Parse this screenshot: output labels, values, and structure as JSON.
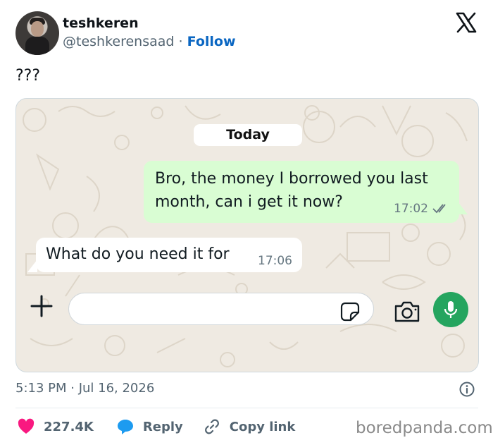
{
  "author": {
    "name": "teshkeren",
    "handle": "@teshkerensaad",
    "separator": "·",
    "follow_label": "Follow",
    "avatar_icon": "profile-photo"
  },
  "platform_logo": "x-logo",
  "tweet": {
    "text": "???",
    "posted": "5:13 PM · Jul 16, 2026"
  },
  "chat": {
    "date_chip": "Today",
    "messages": [
      {
        "direction": "outgoing",
        "text": "Bro, the money I borrowed you last month, can i get it now?",
        "time": "17:02",
        "status_icon": "double-check-icon"
      },
      {
        "direction": "incoming",
        "text": "What do you need it for",
        "time": "17:06"
      }
    ],
    "composer": {
      "placeholder": "",
      "icons": [
        "plus-icon",
        "sticker-icon",
        "camera-icon",
        "microphone-icon"
      ]
    },
    "colors": {
      "background": "#efeae2",
      "outgoing_bubble": "#d9fdd3",
      "incoming_bubble": "#ffffff",
      "mic_button": "#25a55f"
    }
  },
  "actions": {
    "likes": "227.4K",
    "reply_label": "Reply",
    "copy_link_label": "Copy link"
  },
  "colors": {
    "link": "#0a66c2",
    "like": "#f91880",
    "reply": "#1d9bf0",
    "muted": "#536471"
  },
  "watermark": "boredpanda.com"
}
